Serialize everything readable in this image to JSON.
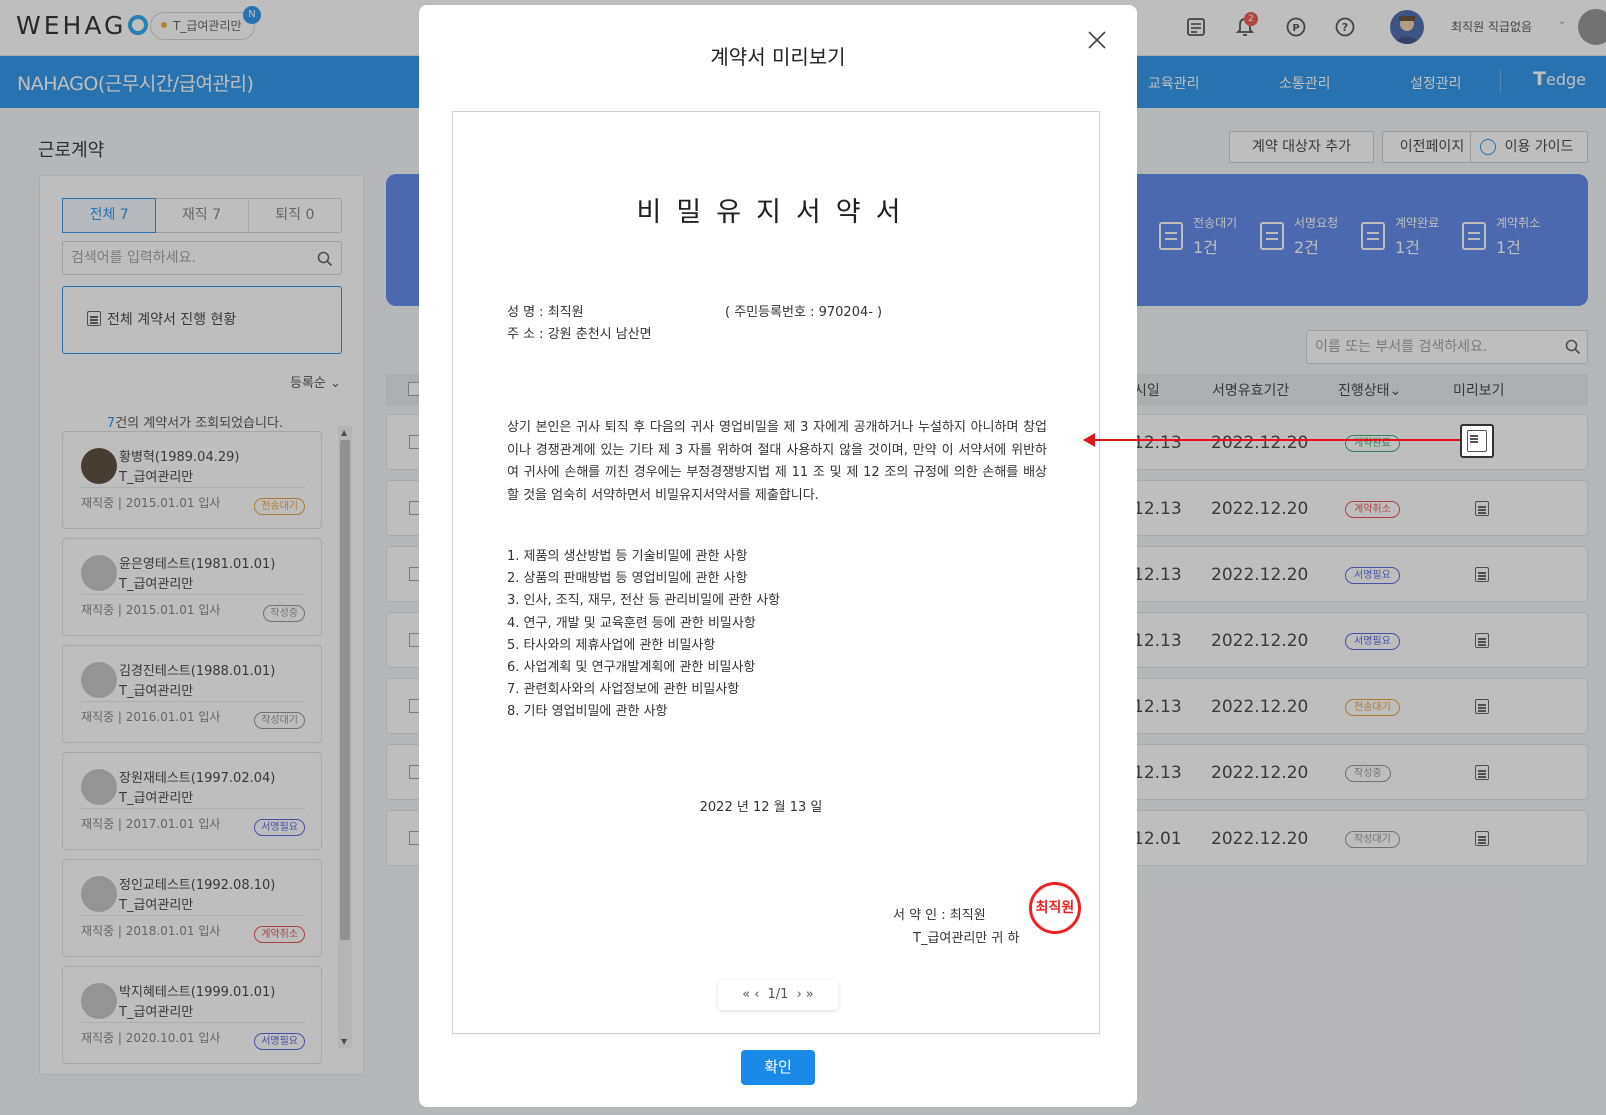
{
  "top": {
    "logo": "WEHAG",
    "company": "T_급여관리만",
    "new_badge": "N",
    "alarm_count": "2",
    "user": "최직원 직급없음"
  },
  "appbar": {
    "title": "NAHAGO(근무시간/급여관리)",
    "nav": [
      "교육관리",
      "소통관리",
      "설정관리"
    ],
    "brand": "edge"
  },
  "page": {
    "title": "근로계약",
    "buttons": [
      "계약 대상자 추가",
      "이전페이지",
      "이용 가이드"
    ]
  },
  "sidebar": {
    "tabs": [
      "전체 7",
      "재직 7",
      "퇴직 0"
    ],
    "search_placeholder": "검색어를 입력하세요.",
    "all_status": "전체 계약서 진행 현황",
    "sort": "등록순",
    "count_num": "7",
    "count_text": "건의 계약서가 조회되었습니다.",
    "employees": [
      {
        "name": "황병혁(1989.04.29)",
        "dept": "T_급여관리만",
        "meta": "재직중 | 2015.01.01 입사",
        "tag": "전송대기",
        "color": "#e89a2a"
      },
      {
        "name": "윤은영테스트(1981.01.01)",
        "dept": "T_급여관리만",
        "meta": "재직중 | 2015.01.01 입사",
        "tag": "작성중",
        "color": "#8a8a8a"
      },
      {
        "name": "김경진테스트(1988.01.01)",
        "dept": "T_급여관리만",
        "meta": "재직중 | 2016.01.01 입사",
        "tag": "작성대기",
        "color": "#8a8a8a"
      },
      {
        "name": "장원재테스트(1997.02.04)",
        "dept": "T_급여관리만",
        "meta": "재직중 | 2017.01.01 입사",
        "tag": "서명필요",
        "color": "#4a5ad8"
      },
      {
        "name": "정인교테스트(1992.08.10)",
        "dept": "T_급여관리만",
        "meta": "재직중 | 2018.01.01 입사",
        "tag": "계약취소",
        "color": "#e0453f"
      },
      {
        "name": "박지혜테스트(1999.01.01)",
        "dept": "T_급여관리만",
        "meta": "재직중 | 2020.10.01 입사",
        "tag": "서명필요",
        "color": "#4a5ad8"
      }
    ]
  },
  "stats": [
    {
      "label": "전송대기",
      "value": "1건"
    },
    {
      "label": "서명요청",
      "value": "2건"
    },
    {
      "label": "계약완료",
      "value": "1건"
    },
    {
      "label": "계약취소",
      "value": "1건"
    }
  ],
  "table": {
    "search_placeholder": "이름 또는 부서를 검색하세요.",
    "headers": [
      "시일",
      "서명유효기간",
      "진행상태",
      "미리보기"
    ],
    "rows": [
      {
        "sign": "12.13",
        "valid": "2022.12.20",
        "tag": "계약완료",
        "color": "#2aa36b"
      },
      {
        "sign": "12.13",
        "valid": "2022.12.20",
        "tag": "계약취소",
        "color": "#e0453f"
      },
      {
        "sign": "12.13",
        "valid": "2022.12.20",
        "tag": "서명필요",
        "color": "#4a5ad8"
      },
      {
        "sign": "12.13",
        "valid": "2022.12.20",
        "tag": "서명필요",
        "color": "#4a5ad8"
      },
      {
        "sign": "12.13",
        "valid": "2022.12.20",
        "tag": "전송대기",
        "color": "#e89a2a"
      },
      {
        "sign": "12.13",
        "valid": "2022.12.20",
        "tag": "작성중",
        "color": "#8a8a8a"
      },
      {
        "sign": "12.01",
        "valid": "2022.12.20",
        "tag": "작성대기",
        "color": "#8a8a8a"
      }
    ]
  },
  "modal": {
    "title": "계약서 미리보기",
    "doc_title": "비밀유지서약서",
    "name_line": "성      명 : 최직원",
    "id_line": "( 주민등록번호 : 970204-                )",
    "addr_line": "주      소 : 강원 춘천시 남산면",
    "paragraph": "상기 본인은 귀사 퇴직 후 다음의 귀사 영업비밀을 제 3 자에게 공개하거나 누설하지 아니하며 창업이나 경쟁관계에 있는 기타 제 3 자를 위하여 절대 사용하지 않을 것이며, 만약 이 서약서에 위반하여 귀사에 손해를 끼친 경우에는 부정경쟁방지법 제 11 조 및 제 12 조의 규정에 의한 손해를 배상할 것을 엄숙히 서약하면서 비밀유지서약서를 제출합니다.",
    "items": [
      "1. 제품의 생산방법 등 기술비밀에 관한 사항",
      "2. 상품의 판매방법 등 영업비밀에 관한 사항",
      "3. 인사, 조직, 재무, 전산 등 관리비밀에 관한 사항",
      "4. 연구, 개발 및 교육훈련 등에 관한 비밀사항",
      "5. 타사와의 제휴사업에 관한 비밀사항",
      "6. 사업계획 및 연구개발계획에 관한 비밀사항",
      "7. 관련회사와의 사업정보에 관한 비밀사항",
      "8. 기타 영업비밀에 관한 사항"
    ],
    "date": "2022 년 12 월 13 일",
    "signer_label": "서 약 인 :      최직원",
    "signer_org": "T_급여관리만 귀     하",
    "seal": "최직원",
    "pager": "1/1",
    "confirm": "확인"
  }
}
